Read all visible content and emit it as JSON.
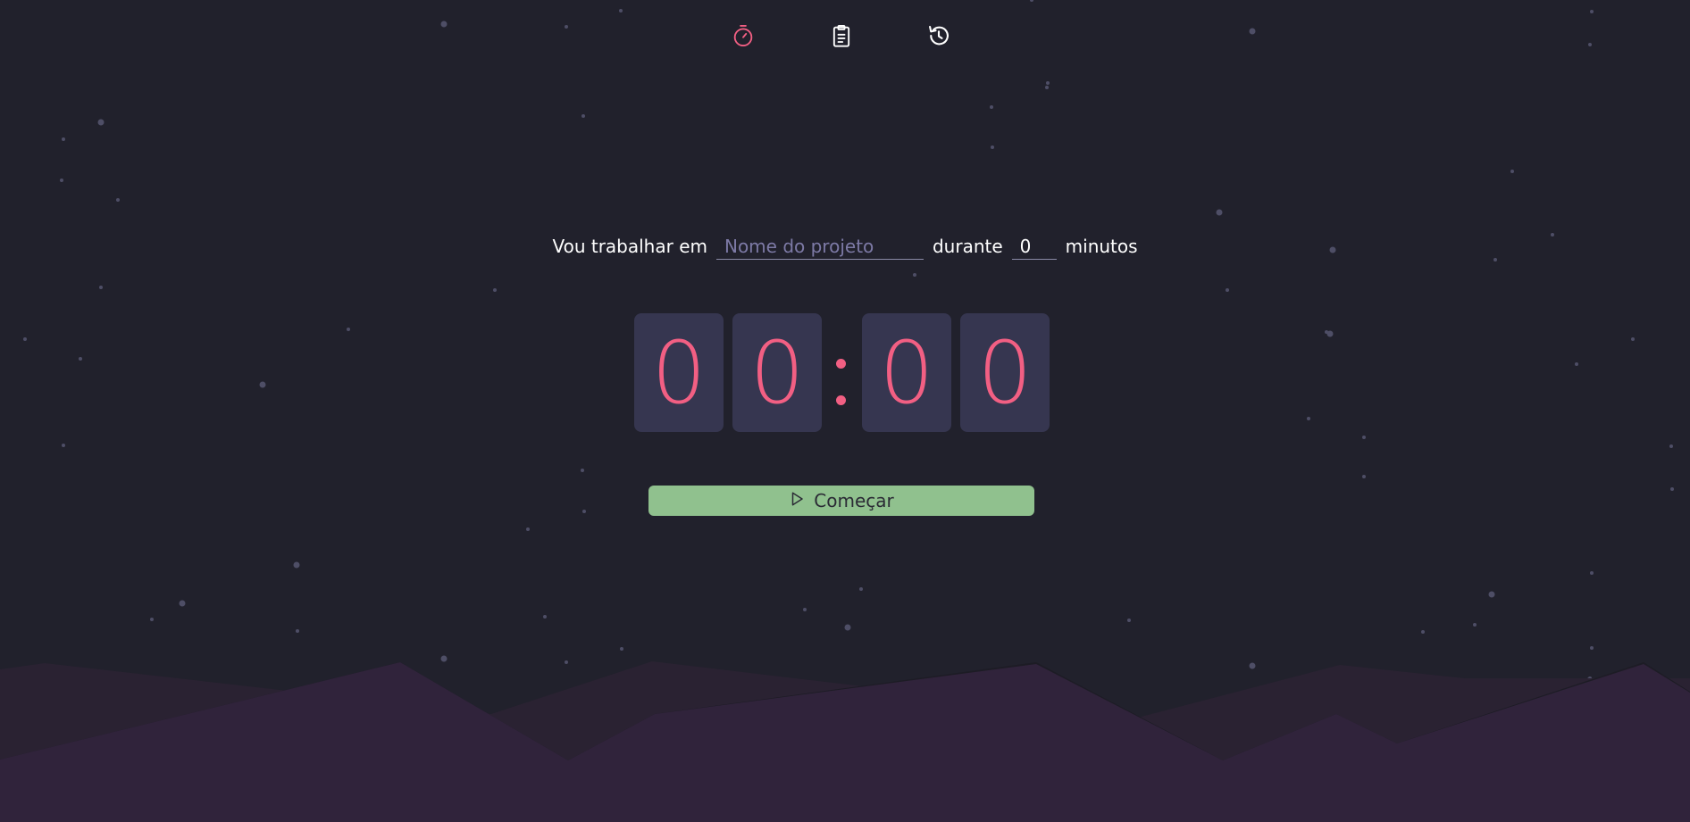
{
  "nav": {
    "items": [
      {
        "icon": "stopwatch-icon",
        "active": true
      },
      {
        "icon": "clipboard-icon",
        "active": false
      },
      {
        "icon": "history-icon",
        "active": false
      }
    ]
  },
  "form": {
    "prefix": "Vou trabalhar em",
    "project_placeholder": "Nome do projeto",
    "project_value": "",
    "middle": "durante",
    "minutes_value": "0",
    "suffix": "minutos"
  },
  "timer": {
    "minutes_tens": "0",
    "minutes_ones": "0",
    "seconds_tens": "0",
    "seconds_ones": "0"
  },
  "start_button": {
    "icon": "play-icon",
    "label": "Começar"
  },
  "colors": {
    "background": "#21212c",
    "accent": "#f25f83",
    "digit_card": "#363650",
    "start_button": "#90c18e",
    "mountain_front": "#30233b",
    "mountain_back": "#2a2232",
    "star": "#4e4e66"
  }
}
